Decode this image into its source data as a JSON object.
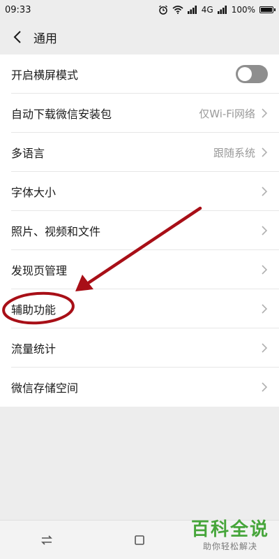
{
  "status_bar": {
    "time": "09:33",
    "network": "4G",
    "battery": "100%"
  },
  "header": {
    "title": "通用"
  },
  "settings": [
    {
      "label": "开启横屏模式",
      "value": "",
      "control": "toggle",
      "on": false
    },
    {
      "label": "自动下载微信安装包",
      "value": "仅Wi-Fi网络",
      "control": "chevron"
    },
    {
      "label": "多语言",
      "value": "跟随系统",
      "control": "chevron"
    },
    {
      "label": "字体大小",
      "value": "",
      "control": "chevron"
    },
    {
      "label": "照片、视频和文件",
      "value": "",
      "control": "chevron"
    },
    {
      "label": "发现页管理",
      "value": "",
      "control": "chevron"
    },
    {
      "label": "辅助功能",
      "value": "",
      "control": "chevron"
    },
    {
      "label": "流量统计",
      "value": "",
      "control": "chevron"
    },
    {
      "label": "微信存储空间",
      "value": "",
      "control": "chevron"
    }
  ],
  "annotation": {
    "color": "#a80f17",
    "highlighted_item": "辅助功能"
  },
  "watermark": {
    "main": "百科全说",
    "sub": "助你轻松解决"
  },
  "icons": [
    "back-icon",
    "chevron-right-icon",
    "alarm-icon",
    "wifi-icon",
    "signal-icon",
    "battery-icon",
    "switch-app-icon",
    "home-square-icon"
  ]
}
